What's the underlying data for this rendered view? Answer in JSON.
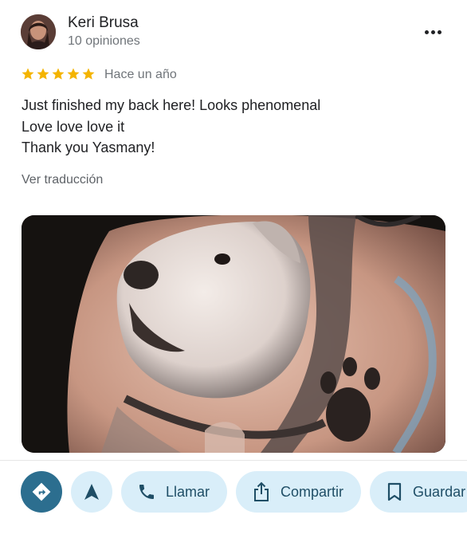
{
  "review": {
    "reviewer_name": "Keri Brusa",
    "review_count": "10 opiniones",
    "rating": 5,
    "max_rating": 5,
    "time_ago": "Hace un año",
    "text_lines": [
      "Just finished my back here! Looks phenomenal",
      "Love love love it",
      "Thank you Yasmany!"
    ],
    "translate_label": "Ver traducción"
  },
  "actions": {
    "call_label": "Llamar",
    "share_label": "Compartir",
    "save_label": "Guardar"
  },
  "colors": {
    "star": "#f4b400",
    "directions_bg": "#2c6e8f",
    "pill_bg": "#d9eef9",
    "pill_text": "#1f4e66"
  },
  "icons": [
    "more-vert-icon",
    "star-icon",
    "directions-icon",
    "navigation-arrow-icon",
    "phone-icon",
    "share-icon",
    "bookmark-icon"
  ]
}
